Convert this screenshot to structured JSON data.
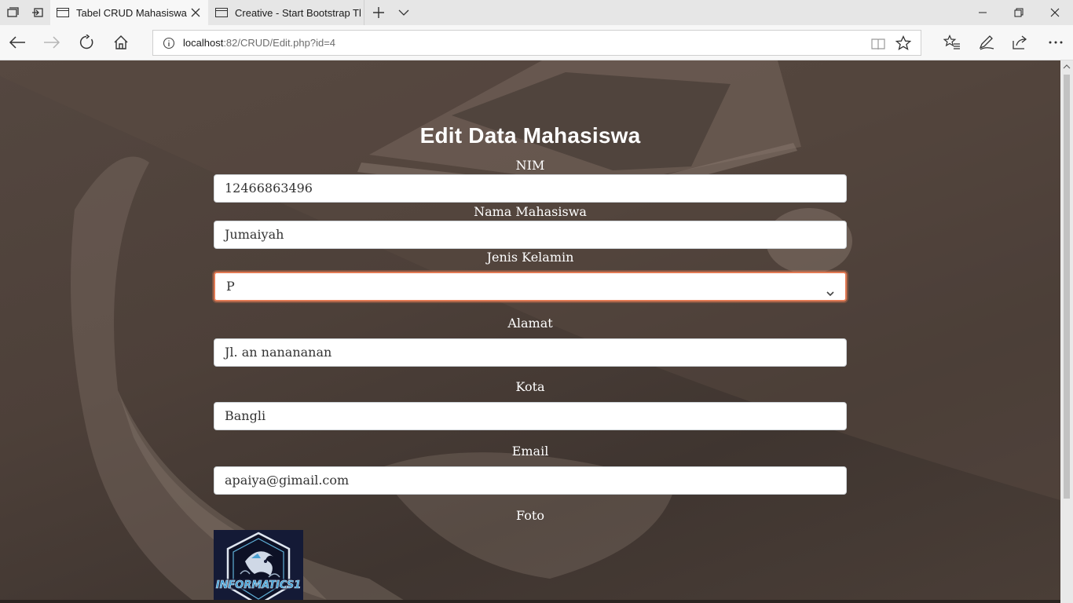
{
  "browser": {
    "tabs": [
      {
        "title": "Tabel CRUD Mahasiswa",
        "active": true
      },
      {
        "title": "Creative - Start Bootstrap Tl",
        "active": false
      }
    ],
    "address": {
      "host": "localhost",
      "rest": ":82/CRUD/Edit.php?id=4"
    }
  },
  "page": {
    "title": "Edit Data Mahasiswa",
    "fields": {
      "nim": {
        "label": "NIM",
        "value": "12466863496"
      },
      "nama": {
        "label": "Nama Mahasiswa",
        "value": "Jumaiyah"
      },
      "jenis_kelamin": {
        "label": "Jenis Kelamin",
        "value": "P"
      },
      "alamat": {
        "label": "Alamat",
        "value": "Jl. an nanananan"
      },
      "kota": {
        "label": "Kota",
        "value": "Bangli"
      },
      "email": {
        "label": "Email",
        "value": "apaiya@gimail.com"
      },
      "foto": {
        "label": "Foto"
      }
    },
    "photo_logo_text": "INFORMATICS1"
  },
  "colors": {
    "accent_focus": "#e27a54",
    "page_overlay": "#4d4039",
    "chrome_bg": "#f7f7f7"
  },
  "icons": [
    "tab-preview-icon",
    "set-aside-tabs-icon",
    "page-icon",
    "close-icon",
    "new-tab-icon",
    "tab-list-chevron-icon",
    "minimize-icon",
    "restore-icon",
    "back-icon",
    "forward-icon",
    "refresh-icon",
    "home-icon",
    "info-icon",
    "reading-view-icon",
    "favorite-star-icon",
    "favorites-hub-icon",
    "web-note-icon",
    "share-icon",
    "more-icon",
    "chevron-down-icon"
  ]
}
